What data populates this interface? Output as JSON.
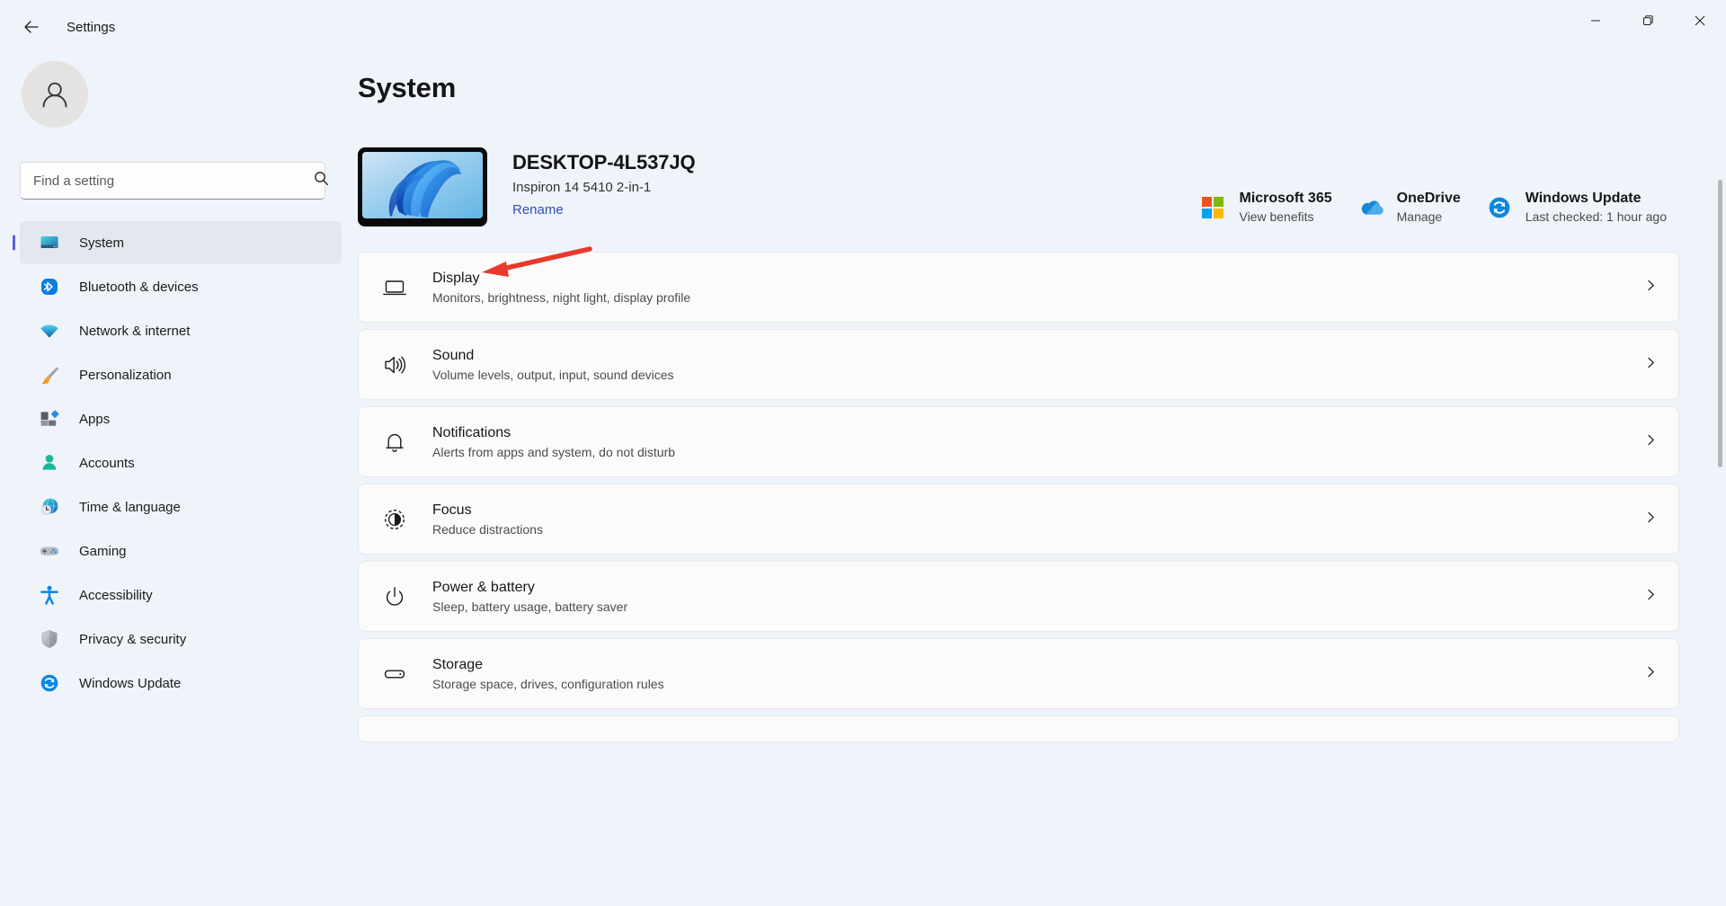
{
  "window": {
    "app_title": "Settings",
    "back_icon": "back-arrow-icon",
    "minimize_label": "–",
    "maximize_label": "❑",
    "close_label": "✕"
  },
  "sidebar": {
    "avatar_icon": "user-avatar-icon",
    "search": {
      "placeholder": "Find a setting",
      "value": "",
      "icon": "search-icon"
    },
    "items": [
      {
        "label": "System",
        "icon": "monitor-icon",
        "selected": true
      },
      {
        "label": "Bluetooth & devices",
        "icon": "bluetooth-icon",
        "selected": false
      },
      {
        "label": "Network & internet",
        "icon": "wifi-icon",
        "selected": false
      },
      {
        "label": "Personalization",
        "icon": "paintbrush-icon",
        "selected": false
      },
      {
        "label": "Apps",
        "icon": "apps-icon",
        "selected": false
      },
      {
        "label": "Accounts",
        "icon": "account-icon",
        "selected": false
      },
      {
        "label": "Time & language",
        "icon": "clock-globe-icon",
        "selected": false
      },
      {
        "label": "Gaming",
        "icon": "gamepad-icon",
        "selected": false
      },
      {
        "label": "Accessibility",
        "icon": "accessibility-icon",
        "selected": false
      },
      {
        "label": "Privacy & security",
        "icon": "shield-icon",
        "selected": false
      },
      {
        "label": "Windows Update",
        "icon": "update-icon",
        "selected": false
      }
    ]
  },
  "main": {
    "page_title": "System",
    "device": {
      "name": "DESKTOP-4L537JQ",
      "model": "Inspiron 14 5410 2-in-1",
      "rename_label": "Rename",
      "thumbnail_icon": "windows-bloom-wallpaper"
    },
    "quick_links": [
      {
        "title": "Microsoft 365",
        "subtitle": "View benefits",
        "icon": "microsoft-logo-icon"
      },
      {
        "title": "OneDrive",
        "subtitle": "Manage",
        "icon": "onedrive-cloud-icon"
      },
      {
        "title": "Windows Update",
        "subtitle": "Last checked: 1 hour ago",
        "icon": "update-icon"
      }
    ],
    "settings_rows": [
      {
        "title": "Display",
        "subtitle": "Monitors, brightness, night light, display profile",
        "icon": "display-icon"
      },
      {
        "title": "Sound",
        "subtitle": "Volume levels, output, input, sound devices",
        "icon": "speaker-icon"
      },
      {
        "title": "Notifications",
        "subtitle": "Alerts from apps and system, do not disturb",
        "icon": "bell-icon"
      },
      {
        "title": "Focus",
        "subtitle": "Reduce distractions",
        "icon": "focus-icon"
      },
      {
        "title": "Power & battery",
        "subtitle": "Sleep, battery usage, battery saver",
        "icon": "power-icon"
      },
      {
        "title": "Storage",
        "subtitle": "Storage space, drives, configuration rules",
        "icon": "storage-icon"
      }
    ],
    "chevron_icon": "chevron-right-icon"
  },
  "annotation": {
    "type": "arrow",
    "color": "#e8392c",
    "points_to": "Display",
    "icon": "red-arrow-annotation"
  },
  "colors": {
    "accent": "#5a5fd4",
    "link": "#2f4fb0",
    "background": "#eff3fa",
    "card": "#fbfbfc",
    "selected_nav": "#e3e7ee",
    "annotation_red": "#e8392c"
  }
}
